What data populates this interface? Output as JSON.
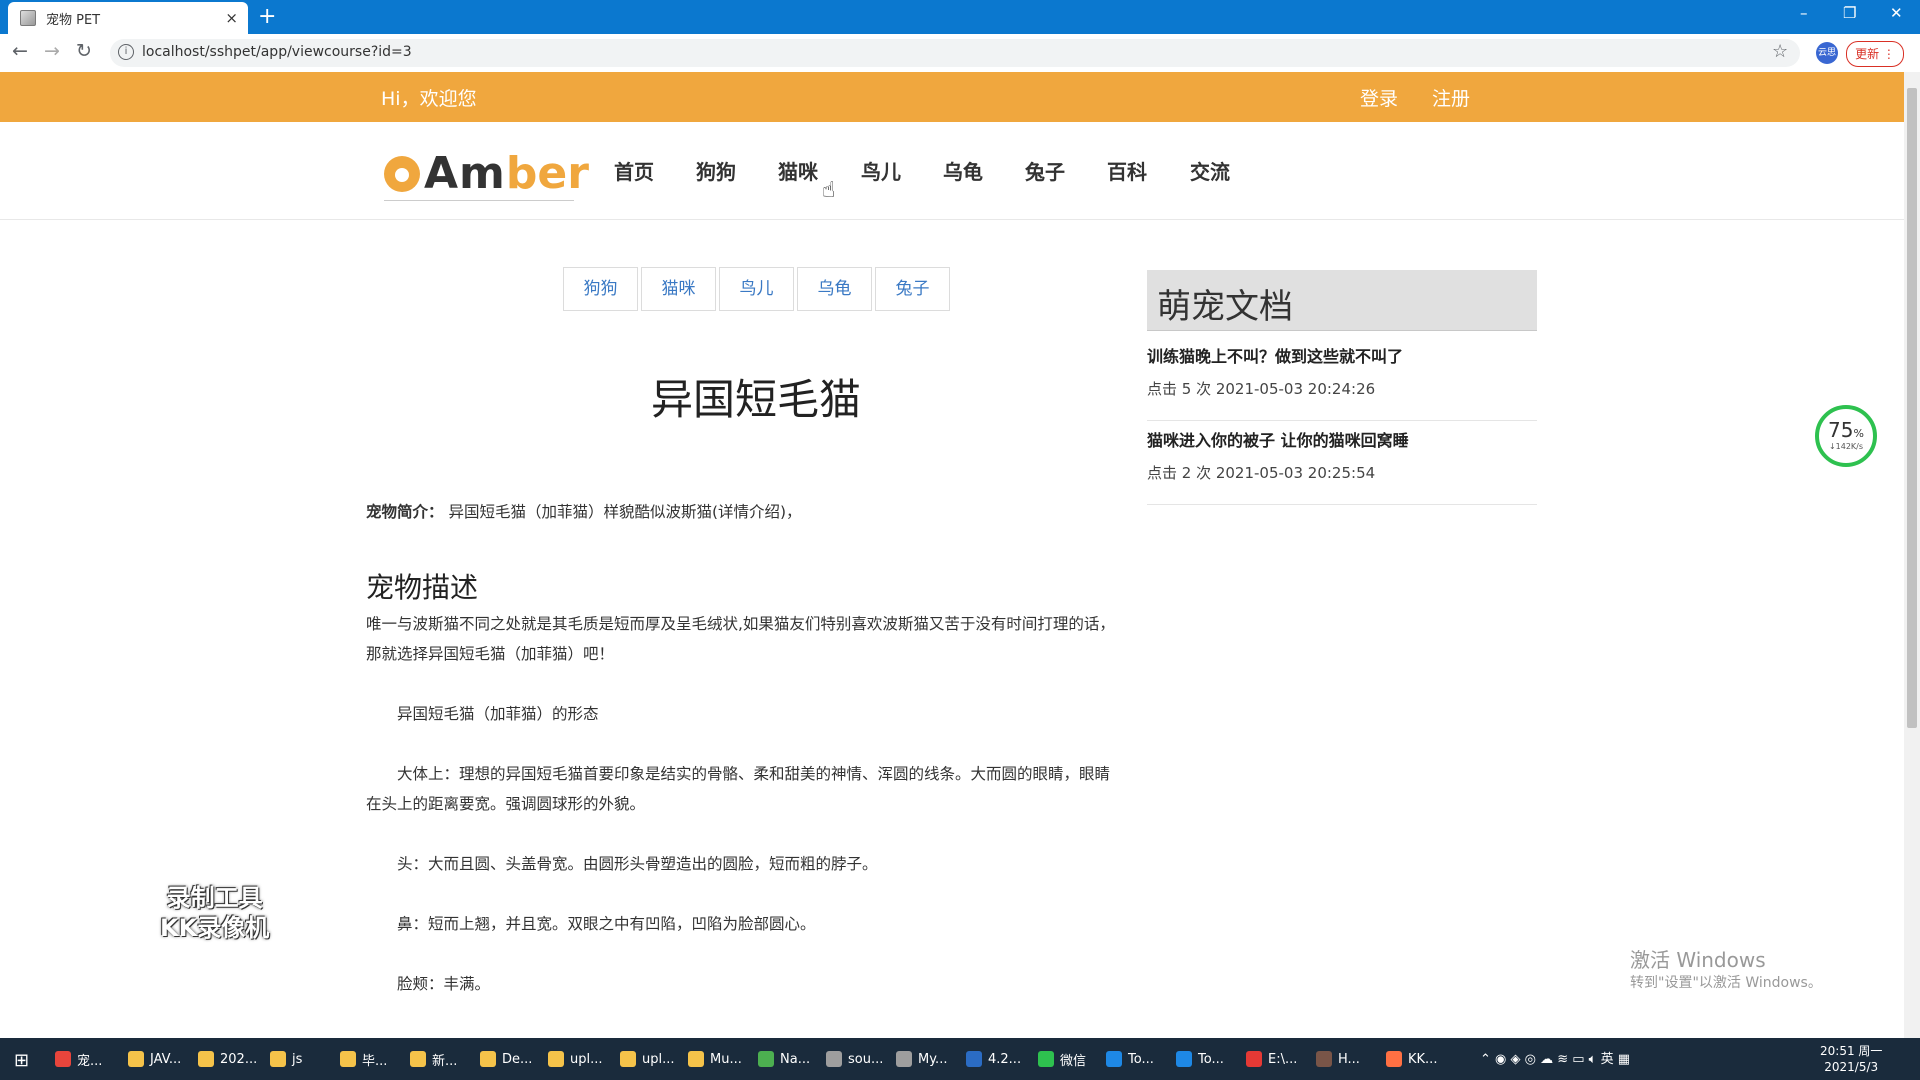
{
  "browser": {
    "tab_title": "宠物 PET",
    "tab_close": "×",
    "new_tab": "+",
    "url": "localhost/sshpet/app/viewcourse?id=3",
    "update_label": "更新",
    "ext_label": "云思",
    "window_controls": [
      "–",
      "❐",
      "✕"
    ]
  },
  "topbar": {
    "greeting": "Hi，欢迎您",
    "login": "登录",
    "register": "注册",
    "color": "#f0a73e"
  },
  "logo": {
    "part1": "Am",
    "part2": "ber"
  },
  "nav": [
    "首页",
    "狗狗",
    "猫咪",
    "鸟儿",
    "乌龟",
    "兔子",
    "百科",
    "交流"
  ],
  "categories": [
    "狗狗",
    "猫咪",
    "鸟儿",
    "乌龟",
    "兔子"
  ],
  "article": {
    "title": "异国短毛猫",
    "intro_label": "宠物简介：",
    "intro_text": "异国短毛猫（加菲猫）样貌酷似波斯猫(详情介绍)，",
    "section_heading": "宠物描述",
    "paragraphs": [
      "唯一与波斯猫不同之处就是其毛质是短而厚及呈毛绒状,如果猫友们特别喜欢波斯猫又苦于没有时间打理的话，",
      "那就选择异国短毛猫（加菲猫）吧！",
      "异国短毛猫（加菲猫）的形态",
      "大体上：理想的异国短毛猫首要印象是结实的骨骼、柔和甜美的神情、浑圆的线条。大而圆的眼睛，眼睛",
      "在头上的距离要宽。强调圆球形的外貌。",
      "头：大而且圆、头盖骨宽。由圆形头骨塑造出的圆脸，短而粗的脖子。",
      "鼻：短而上翘，并且宽。双眼之中有凹陷，凹陷为脸部圆心。",
      "脸颊：丰满。"
    ]
  },
  "sidebar": {
    "title": "萌宠文档",
    "items": [
      {
        "title": "训练猫晚上不叫？做到这些就不叫了",
        "meta": "点击 5 次 2021-05-03 20:24:26"
      },
      {
        "title": "猫咪进入你的被子 让你的猫咪回窝睡",
        "meta": "点击 2 次 2021-05-03 20:25:54"
      }
    ]
  },
  "speed_widget": {
    "percent": "75",
    "unit": "%",
    "rate": "↓142K/s"
  },
  "watermark": {
    "line1": "录制工具",
    "line2": "KK录像机"
  },
  "activation": {
    "line1": "激活 Windows",
    "line2": "转到\"设置\"以激活 Windows。"
  },
  "taskbar": {
    "items": [
      {
        "label": "宠...",
        "color": "#e8453c"
      },
      {
        "label": "JAV...",
        "color": "#f5c34a"
      },
      {
        "label": "202...",
        "color": "#f5c34a"
      },
      {
        "label": "js",
        "color": "#f5c34a"
      },
      {
        "label": "毕...",
        "color": "#f5c34a"
      },
      {
        "label": "新...",
        "color": "#f5c34a"
      },
      {
        "label": "De...",
        "color": "#f5c34a"
      },
      {
        "label": "upl...",
        "color": "#f5c34a"
      },
      {
        "label": "upl...",
        "color": "#f5c34a"
      },
      {
        "label": "Mu...",
        "color": "#f5c34a"
      },
      {
        "label": "Na...",
        "color": "#4caf50"
      },
      {
        "label": "sou...",
        "color": "#9e9e9e"
      },
      {
        "label": "My...",
        "color": "#9e9e9e"
      },
      {
        "label": "4.2...",
        "color": "#2b6cc4"
      },
      {
        "label": "微信",
        "color": "#2ec14f"
      },
      {
        "label": "To...",
        "color": "#1e88e5"
      },
      {
        "label": "To...",
        "color": "#1e88e5"
      },
      {
        "label": "E:\\...",
        "color": "#e53935"
      },
      {
        "label": "H...",
        "color": "#795548"
      },
      {
        "label": "KK...",
        "color": "#ff7043"
      }
    ],
    "tray_text": "英",
    "time": "20:51 周一",
    "date": "2021/5/3"
  }
}
